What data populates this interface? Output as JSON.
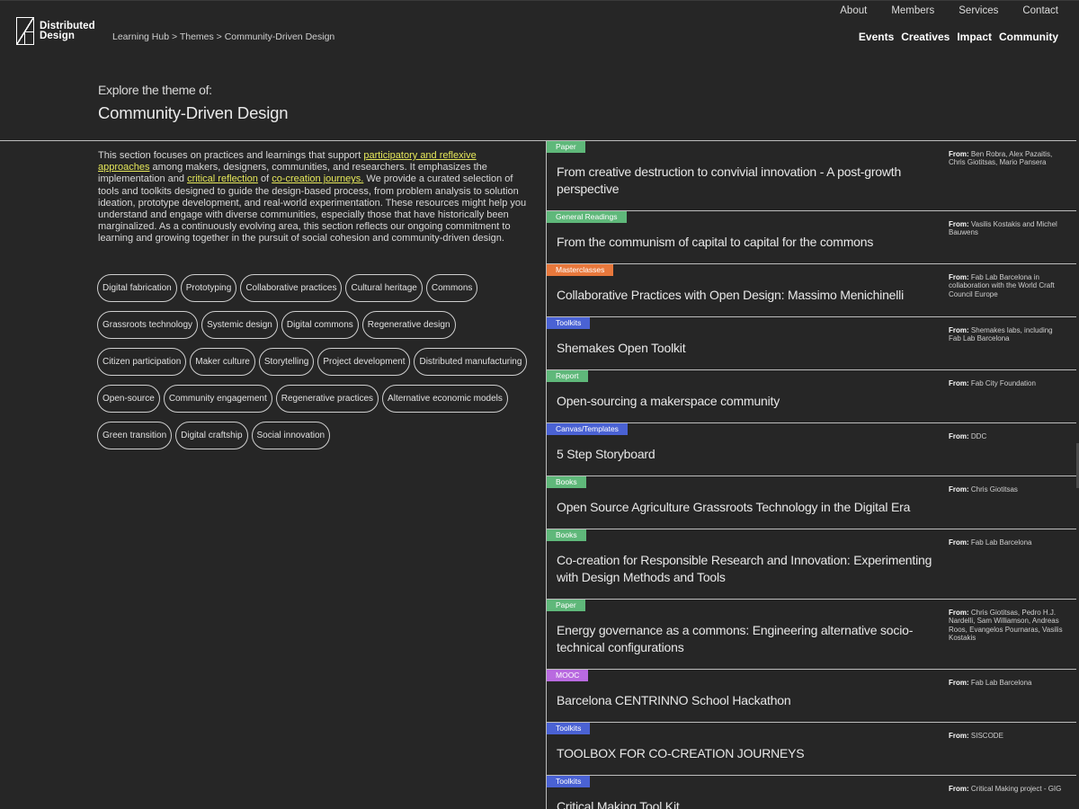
{
  "header": {
    "logo_line1": "Distributed",
    "logo_line2": "Design",
    "breadcrumb": "Learning Hub > Themes > Community-Driven Design",
    "top_nav": [
      "About",
      "Members",
      "Services",
      "Contact"
    ],
    "main_nav": [
      "Events",
      "Creatives",
      "Impact",
      "Community"
    ]
  },
  "intro": {
    "kicker": "Explore the theme of:",
    "title": "Community-Driven Design"
  },
  "description": {
    "part1": "This section focuses on practices and learnings that support ",
    "link1": "participatory and reflexive approaches",
    "part2": " among makers, designers, communities, and researchers. It emphasizes the implementation and ",
    "link2": "critical reflection",
    "part3": " of ",
    "link3": "co-creation journeys.",
    "part4": " We provide a curated selection of tools and toolkits designed to guide the design-based process, from problem analysis to solution ideation, prototype development, and real-world experimentation. These resources might help you understand and engage with diverse communities, especially those that have historically been marginalized. As a continuously evolving area, this section reflects our ongoing commitment to learning and growing together in the pursuit of social cohesion and community-driven design."
  },
  "tags": [
    "Digital fabrication",
    "Prototyping",
    "Collaborative practices",
    "Cultural heritage",
    "Commons",
    "Grassroots technology",
    "Systemic design",
    "Digital commons",
    "Regenerative design",
    "Citizen participation",
    "Maker culture",
    "Storytelling",
    "Project development",
    "Distributed manufacturing",
    "Open-source",
    "Community engagement",
    "Regenerative practices",
    "Alternative economic models",
    "Green transition",
    "Digital craftship",
    "Social innovation"
  ],
  "from_label": "From:",
  "items": [
    {
      "type": "Paper",
      "color": "#5fb87a",
      "title": "From creative destruction to convivial innovation - A post-growth perspective",
      "from": "Ben Robra, Alex Pazaitis, Chris Giotitsas, Mario Pansera"
    },
    {
      "type": "General Readings",
      "color": "#5fb87a",
      "title": "From the communism of capital to capital for the commons",
      "from": "Vasilis Kostakis and Michel Bauwens"
    },
    {
      "type": "Masterclasses",
      "color": "#e8783c",
      "title": "Collaborative Practices with Open Design: Massimo Menichinelli",
      "from": "Fab Lab Barcelona in collaboration with the World Craft Council Europe"
    },
    {
      "type": "Toolkits",
      "color": "#4a62d4",
      "title": "Shemakes Open Toolkit",
      "from": "Shemakes labs, including Fab Lab Barcelona"
    },
    {
      "type": "Report",
      "color": "#5fb87a",
      "title": "Open-sourcing a makerspace community",
      "from": "Fab City Foundation"
    },
    {
      "type": "Canvas/Templates",
      "color": "#4a62d4",
      "title": "5 Step Storyboard",
      "from": "DDC"
    },
    {
      "type": "Books",
      "color": "#5fb87a",
      "title": "Open Source Agriculture Grassroots Technology in the Digital Era",
      "from": "Chris Giotitsas"
    },
    {
      "type": "Books",
      "color": "#5fb87a",
      "title": "Co-creation for Responsible Research and Innovation: Experimenting with Design Methods and Tools",
      "from": "Fab Lab Barcelona"
    },
    {
      "type": "Paper",
      "color": "#5fb87a",
      "title": "Energy governance as a commons: Engineering alternative socio-technical configurations",
      "from": "Chris Giotitsas, Pedro H.J. Nardelli, Sam Williamson, Andreas Roos, Evangelos Pournaras, Vasilis Kostakis"
    },
    {
      "type": "MOOC",
      "color": "#b96ae0",
      "title": "Barcelona CENTRINNO School Hackathon",
      "from": "Fab Lab Barcelona"
    },
    {
      "type": "Toolkits",
      "color": "#4a62d4",
      "title": "TOOLBOX FOR CO-CREATION JOURNEYS",
      "from": "SISCODE"
    },
    {
      "type": "Toolkits",
      "color": "#4a62d4",
      "title": "Critical Making Tool Kit",
      "from": "Critical Making project - GIG"
    }
  ]
}
